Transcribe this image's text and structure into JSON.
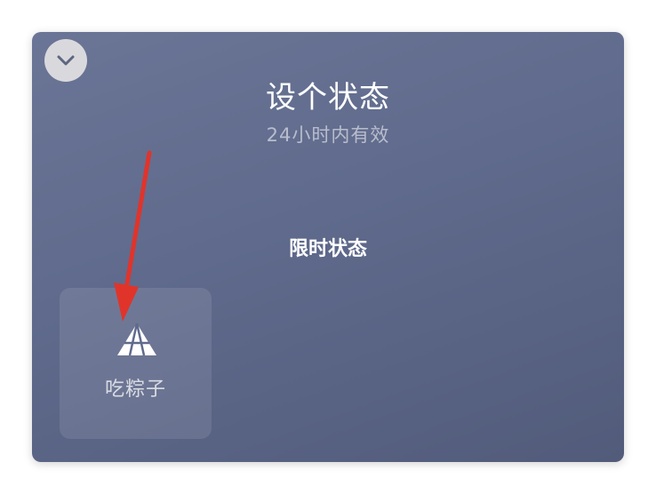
{
  "panel": {
    "title": "设个状态",
    "subtitle": "24小时内有效",
    "section_title": "限时状态",
    "collapse_icon": "chevron-down-icon"
  },
  "statuses": [
    {
      "label": "吃粽子",
      "icon": "zongzi-icon"
    }
  ],
  "colors": {
    "panel_bg": "#5f6a8c",
    "arrow": "#e0342b"
  }
}
